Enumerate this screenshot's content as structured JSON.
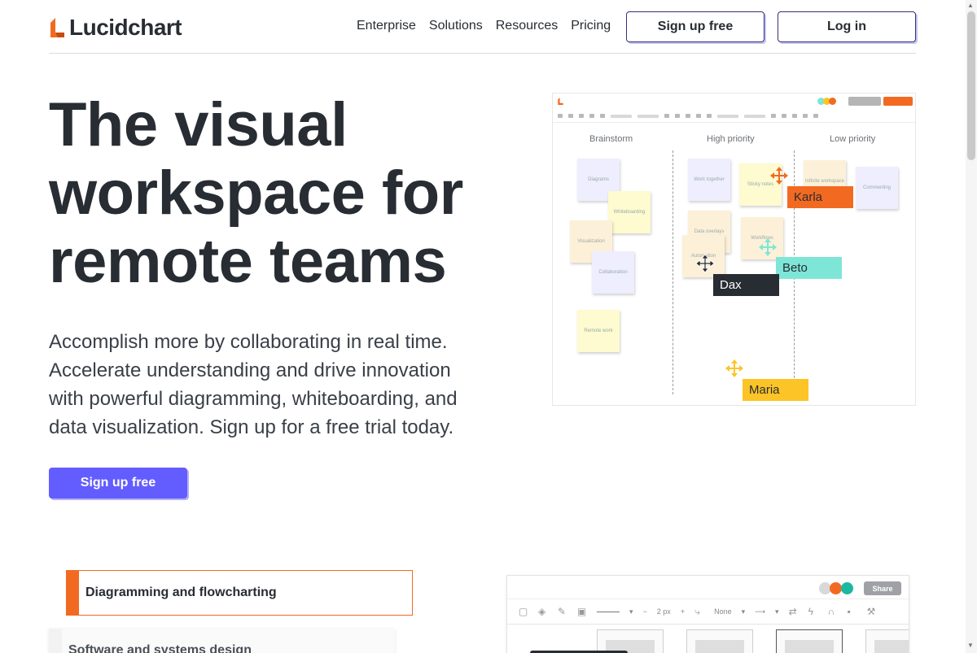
{
  "header": {
    "logo_text": "Lucidchart",
    "nav": [
      "Enterprise",
      "Solutions",
      "Resources",
      "Pricing"
    ],
    "signup_label": "Sign up free",
    "login_label": "Log in"
  },
  "hero": {
    "title": "The visual workspace for remote teams",
    "subtitle": "Accomplish more by collaborating in real time. Accelerate understanding and drive innovation with powerful diagramming, whiteboarding, and data visualization. Sign up for a free trial today.",
    "cta_label": "Sign up free"
  },
  "board": {
    "columns": [
      "Brainstorm",
      "High priority",
      "Low priority"
    ],
    "notes": [
      "Diagrams",
      "Whiteboarding",
      "Visualization",
      "Collaboration",
      "Remote work",
      "Work together",
      "Sticky notes",
      "Data overlays",
      "Workflows",
      "Automation",
      "Infinite workspace",
      "Commenting"
    ],
    "cursors": [
      {
        "name": "Karla",
        "color": "#f26a21",
        "text_color": "#282c33"
      },
      {
        "name": "Beto",
        "color": "#7ee6d6",
        "text_color": "#282c33"
      },
      {
        "name": "Dax",
        "color": "#282c33",
        "text_color": "#ffffff"
      },
      {
        "name": "Maria",
        "color": "#fcc426",
        "text_color": "#282c33"
      }
    ]
  },
  "features": {
    "active_tab": "Diagramming and flowcharting",
    "next_tab": "Software and systems design"
  },
  "mock2": {
    "share_label": "Share",
    "size_value": "2 px",
    "arrow_value": "None"
  },
  "colors": {
    "brand_orange": "#f26a21",
    "brand_purple": "#635dff",
    "text_dark": "#282c33"
  }
}
